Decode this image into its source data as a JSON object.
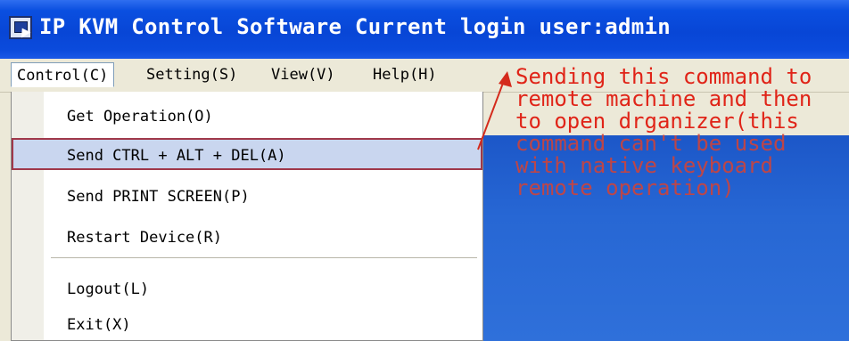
{
  "window": {
    "title": "IP KVM Control Software Current login user:admin"
  },
  "menubar": {
    "items": [
      {
        "label": "Control(C)"
      },
      {
        "label": "Setting(S)"
      },
      {
        "label": "View(V)"
      },
      {
        "label": "Help(H)"
      }
    ]
  },
  "dropdown": {
    "items": [
      {
        "label": "Get Operation(O)"
      },
      {
        "label": "Send CTRL + ALT + DEL(A)"
      },
      {
        "label": "Send PRINT SCREEN(P)"
      },
      {
        "label": "Restart Device(R)"
      },
      {
        "label": "Logout(L)"
      },
      {
        "label": "Exit(X)"
      }
    ],
    "selected_index": 1
  },
  "annotation": {
    "lines": [
      "Sending this command to",
      "remote machine and then",
      "to open drganizer(this",
      "command can't be used",
      "with native keyboard",
      "remote operation)"
    ],
    "color": "#e02418"
  },
  "colors": {
    "titlebar": "#0846d6",
    "desktop": "#2767d4",
    "selection_border": "#a0384a"
  }
}
